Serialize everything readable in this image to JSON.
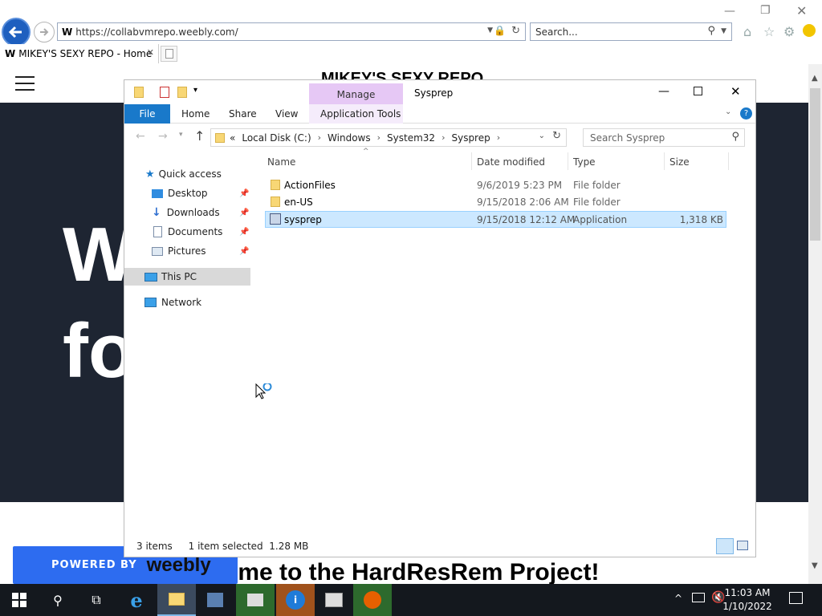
{
  "browser": {
    "address": "https://collabvmrepo.weebly.com/",
    "search_placeholder": "Search...",
    "tab_title": "MIKEY'S SEXY REPO - Home"
  },
  "website": {
    "header_title": "MIKEY'S SEXY REPO",
    "hero_text": "W\nfo",
    "welcome_text": "ome to the HardResRem Project!",
    "powered_label": "POWERED BY",
    "powered_brand": "weebly"
  },
  "explorer": {
    "window_title": "Sysprep",
    "manage_label": "Manage",
    "ribbon_tabs": [
      "File",
      "Home",
      "Share",
      "View",
      "Application Tools"
    ],
    "breadcrumb": [
      "«",
      "Local Disk (C:)",
      "Windows",
      "System32",
      "Sysprep"
    ],
    "search_placeholder": "Search Sysprep",
    "nav": {
      "quick_access": "Quick access",
      "desktop": "Desktop",
      "downloads": "Downloads",
      "documents": "Documents",
      "pictures": "Pictures",
      "this_pc": "This PC",
      "network": "Network"
    },
    "columns": [
      "Name",
      "Date modified",
      "Type",
      "Size"
    ],
    "files": [
      {
        "name": "ActionFiles",
        "date": "9/6/2019 5:23 PM",
        "type": "File folder",
        "size": "",
        "selected": false
      },
      {
        "name": "en-US",
        "date": "9/15/2018 2:06 AM",
        "type": "File folder",
        "size": "",
        "selected": false
      },
      {
        "name": "sysprep",
        "date": "9/15/2018 12:12 AM",
        "type": "Application",
        "size": "1,318 KB",
        "selected": true
      }
    ],
    "status": {
      "items": "3 items",
      "selected": "1 item selected  1.28 MB"
    }
  },
  "taskbar": {
    "time": "11:03 AM",
    "date": "1/10/2022",
    "apps": [
      "start-icon",
      "search-icon",
      "task-view-icon",
      "ie-icon",
      "file-explorer-icon",
      "server-manager-icon",
      "notepad-icon",
      "info-icon",
      "tool-icon",
      "firefox-icon"
    ]
  },
  "colors": {
    "hero_bg": "#1e2532",
    "weebly_blue": "#2d6cf0",
    "file_tab": "#1979ca",
    "manage_tab": "#e6c8f5",
    "selection": "#cce8ff",
    "taskbar": "#14181e"
  }
}
